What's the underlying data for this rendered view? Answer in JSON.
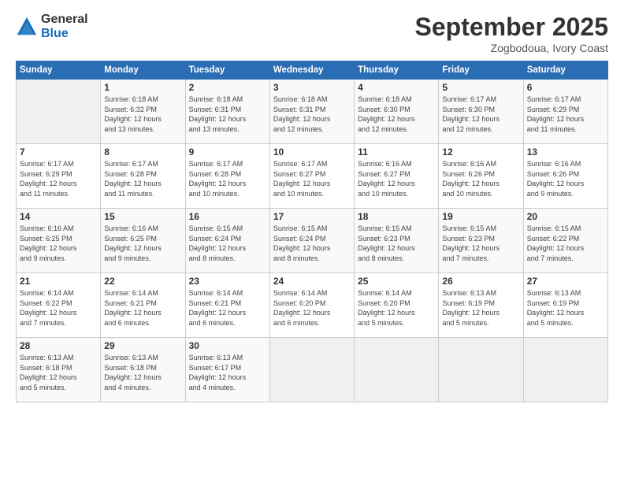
{
  "header": {
    "logo": {
      "general": "General",
      "blue": "Blue"
    },
    "title": "September 2025",
    "subtitle": "Zogbodoua, Ivory Coast"
  },
  "weekdays": [
    "Sunday",
    "Monday",
    "Tuesday",
    "Wednesday",
    "Thursday",
    "Friday",
    "Saturday"
  ],
  "weeks": [
    [
      {
        "day": "",
        "info": ""
      },
      {
        "day": "1",
        "info": "Sunrise: 6:18 AM\nSunset: 6:32 PM\nDaylight: 12 hours\nand 13 minutes."
      },
      {
        "day": "2",
        "info": "Sunrise: 6:18 AM\nSunset: 6:31 PM\nDaylight: 12 hours\nand 13 minutes."
      },
      {
        "day": "3",
        "info": "Sunrise: 6:18 AM\nSunset: 6:31 PM\nDaylight: 12 hours\nand 12 minutes."
      },
      {
        "day": "4",
        "info": "Sunrise: 6:18 AM\nSunset: 6:30 PM\nDaylight: 12 hours\nand 12 minutes."
      },
      {
        "day": "5",
        "info": "Sunrise: 6:17 AM\nSunset: 6:30 PM\nDaylight: 12 hours\nand 12 minutes."
      },
      {
        "day": "6",
        "info": "Sunrise: 6:17 AM\nSunset: 6:29 PM\nDaylight: 12 hours\nand 11 minutes."
      }
    ],
    [
      {
        "day": "7",
        "info": "Sunrise: 6:17 AM\nSunset: 6:29 PM\nDaylight: 12 hours\nand 11 minutes."
      },
      {
        "day": "8",
        "info": "Sunrise: 6:17 AM\nSunset: 6:28 PM\nDaylight: 12 hours\nand 11 minutes."
      },
      {
        "day": "9",
        "info": "Sunrise: 6:17 AM\nSunset: 6:28 PM\nDaylight: 12 hours\nand 10 minutes."
      },
      {
        "day": "10",
        "info": "Sunrise: 6:17 AM\nSunset: 6:27 PM\nDaylight: 12 hours\nand 10 minutes."
      },
      {
        "day": "11",
        "info": "Sunrise: 6:16 AM\nSunset: 6:27 PM\nDaylight: 12 hours\nand 10 minutes."
      },
      {
        "day": "12",
        "info": "Sunrise: 6:16 AM\nSunset: 6:26 PM\nDaylight: 12 hours\nand 10 minutes."
      },
      {
        "day": "13",
        "info": "Sunrise: 6:16 AM\nSunset: 6:26 PM\nDaylight: 12 hours\nand 9 minutes."
      }
    ],
    [
      {
        "day": "14",
        "info": "Sunrise: 6:16 AM\nSunset: 6:25 PM\nDaylight: 12 hours\nand 9 minutes."
      },
      {
        "day": "15",
        "info": "Sunrise: 6:16 AM\nSunset: 6:25 PM\nDaylight: 12 hours\nand 9 minutes."
      },
      {
        "day": "16",
        "info": "Sunrise: 6:15 AM\nSunset: 6:24 PM\nDaylight: 12 hours\nand 8 minutes."
      },
      {
        "day": "17",
        "info": "Sunrise: 6:15 AM\nSunset: 6:24 PM\nDaylight: 12 hours\nand 8 minutes."
      },
      {
        "day": "18",
        "info": "Sunrise: 6:15 AM\nSunset: 6:23 PM\nDaylight: 12 hours\nand 8 minutes."
      },
      {
        "day": "19",
        "info": "Sunrise: 6:15 AM\nSunset: 6:23 PM\nDaylight: 12 hours\nand 7 minutes."
      },
      {
        "day": "20",
        "info": "Sunrise: 6:15 AM\nSunset: 6:22 PM\nDaylight: 12 hours\nand 7 minutes."
      }
    ],
    [
      {
        "day": "21",
        "info": "Sunrise: 6:14 AM\nSunset: 6:22 PM\nDaylight: 12 hours\nand 7 minutes."
      },
      {
        "day": "22",
        "info": "Sunrise: 6:14 AM\nSunset: 6:21 PM\nDaylight: 12 hours\nand 6 minutes."
      },
      {
        "day": "23",
        "info": "Sunrise: 6:14 AM\nSunset: 6:21 PM\nDaylight: 12 hours\nand 6 minutes."
      },
      {
        "day": "24",
        "info": "Sunrise: 6:14 AM\nSunset: 6:20 PM\nDaylight: 12 hours\nand 6 minutes."
      },
      {
        "day": "25",
        "info": "Sunrise: 6:14 AM\nSunset: 6:20 PM\nDaylight: 12 hours\nand 5 minutes."
      },
      {
        "day": "26",
        "info": "Sunrise: 6:13 AM\nSunset: 6:19 PM\nDaylight: 12 hours\nand 5 minutes."
      },
      {
        "day": "27",
        "info": "Sunrise: 6:13 AM\nSunset: 6:19 PM\nDaylight: 12 hours\nand 5 minutes."
      }
    ],
    [
      {
        "day": "28",
        "info": "Sunrise: 6:13 AM\nSunset: 6:18 PM\nDaylight: 12 hours\nand 5 minutes."
      },
      {
        "day": "29",
        "info": "Sunrise: 6:13 AM\nSunset: 6:18 PM\nDaylight: 12 hours\nand 4 minutes."
      },
      {
        "day": "30",
        "info": "Sunrise: 6:13 AM\nSunset: 6:17 PM\nDaylight: 12 hours\nand 4 minutes."
      },
      {
        "day": "",
        "info": ""
      },
      {
        "day": "",
        "info": ""
      },
      {
        "day": "",
        "info": ""
      },
      {
        "day": "",
        "info": ""
      }
    ]
  ]
}
